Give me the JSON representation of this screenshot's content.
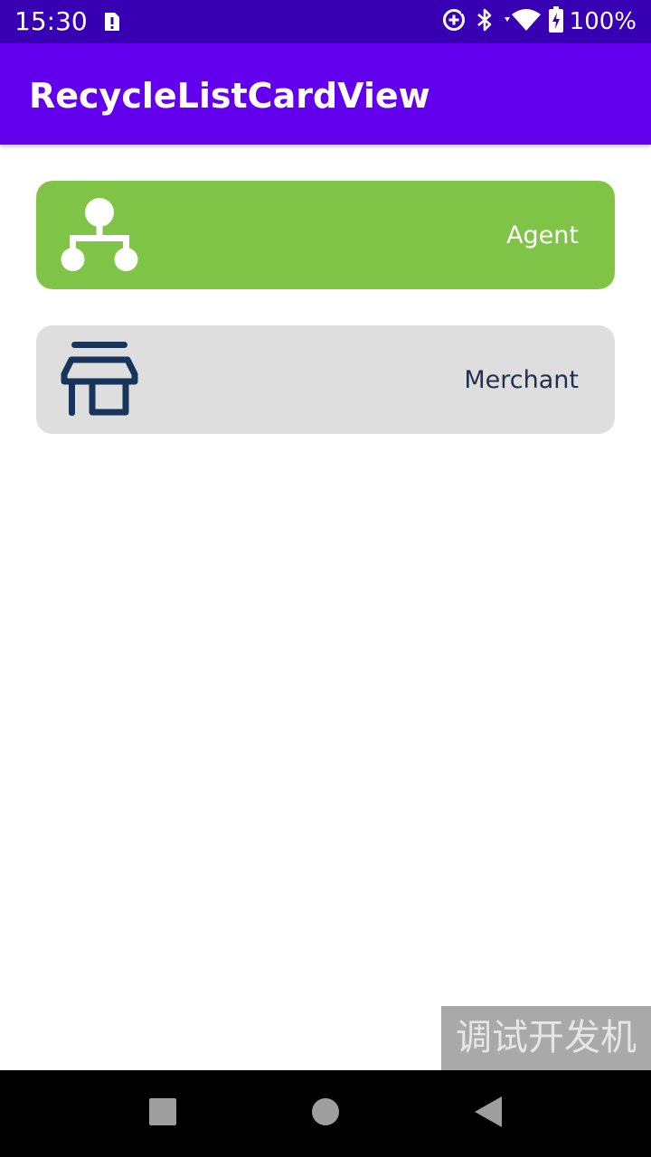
{
  "status_bar": {
    "time": "15:30",
    "battery_text": "100%",
    "icons": [
      "sim-alert-icon",
      "data-saver-icon",
      "bluetooth-icon",
      "wifi-icon",
      "battery-charging-icon"
    ]
  },
  "app_bar": {
    "title": "RecycleListCardView"
  },
  "cards": [
    {
      "label": "Agent",
      "icon": "org-chart-icon",
      "background": "#7fc446",
      "text_color": "#ffffff"
    },
    {
      "label": "Merchant",
      "icon": "store-icon",
      "background": "#dedede",
      "text_color": "#1e3050"
    }
  ],
  "watermark": {
    "text": "调试开发机"
  },
  "nav_bar": {
    "buttons": [
      "recents-button",
      "home-button",
      "back-button"
    ]
  },
  "colors": {
    "status_bar": "#3700b3",
    "app_bar": "#6200ee",
    "agent_card": "#7fc446",
    "merchant_card": "#dedede",
    "merchant_icon": "#17345a"
  }
}
